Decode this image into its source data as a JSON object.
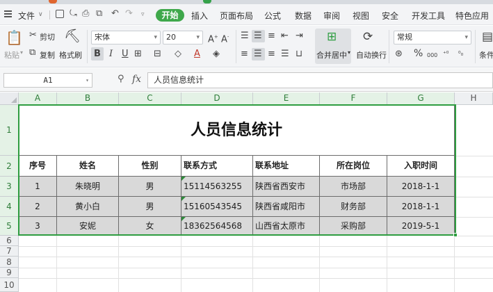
{
  "menubar": {
    "file_menu": "文件",
    "start_tab": "开始",
    "tabs": [
      "插入",
      "页面布局",
      "公式",
      "数据",
      "审阅",
      "视图",
      "安全",
      "开发工具",
      "特色应用"
    ]
  },
  "ribbon": {
    "paste": "粘贴",
    "cut": "剪切",
    "copy": "复制",
    "format_painter": "格式刷",
    "font_name": "宋体",
    "font_size": "20",
    "bold": "B",
    "italic": "I",
    "underline": "U",
    "merge_center": "合并居中",
    "wrap_text": "自动换行",
    "number_format": "常规",
    "percent": "%",
    "thousands": "000",
    "conditional": "条件"
  },
  "formula_bar": {
    "name_box": "A1",
    "fx": "fx",
    "content": "人员信息统计"
  },
  "sheet": {
    "columns": [
      "A",
      "B",
      "C",
      "D",
      "E",
      "F",
      "G",
      "H"
    ],
    "rows": [
      "1",
      "2",
      "3",
      "4",
      "5",
      "6",
      "7",
      "8",
      "9",
      "10"
    ],
    "title": "人员信息统计",
    "headers": [
      "序号",
      "姓名",
      "性别",
      "联系方式",
      "联系地址",
      "所在岗位",
      "入职时间"
    ],
    "records": [
      [
        "1",
        "朱晓明",
        "男",
        "15114563255",
        "陕西省西安市",
        "市场部",
        "2018-1-1"
      ],
      [
        "2",
        "黄小白",
        "男",
        "15160543545",
        "陕西省咸阳市",
        "财务部",
        "2018-1-1"
      ],
      [
        "3",
        "安妮",
        "女",
        "18362564568",
        "山西省太原市",
        "采购部",
        "2019-5-1"
      ]
    ]
  },
  "colors": {
    "accent_green": "#3fa84b",
    "selection_border": "#2e9d40",
    "data_fill": "#d9d9d9"
  }
}
